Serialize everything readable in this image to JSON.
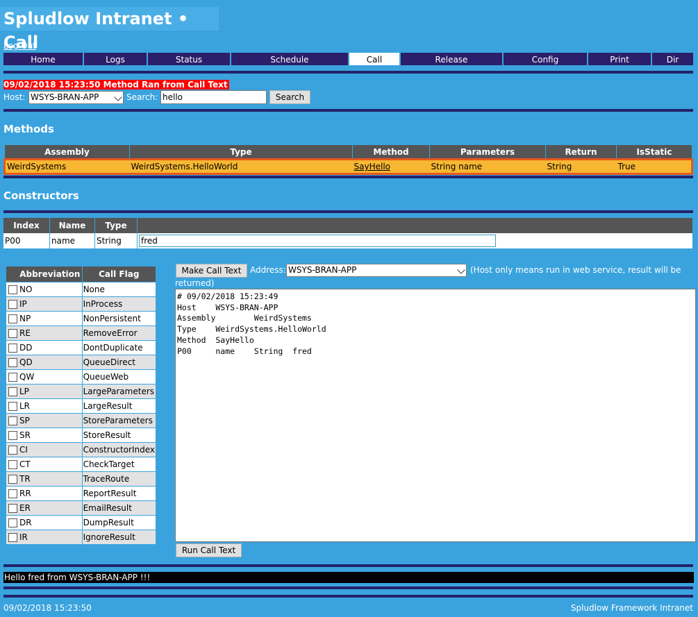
{
  "header": {
    "title": "Spludlow Intranet • Call",
    "logout": "Log Out"
  },
  "nav": {
    "tabs": [
      {
        "label": "Home"
      },
      {
        "label": "Logs"
      },
      {
        "label": "Status"
      },
      {
        "label": "Schedule"
      },
      {
        "label": "Call"
      },
      {
        "label": "Release"
      },
      {
        "label": "Config"
      },
      {
        "label": "Print"
      },
      {
        "label": "Dir"
      }
    ],
    "active": "Call"
  },
  "status_message": "09/02/2018 15:23:50 Method Ran from Call Text",
  "host_row": {
    "host_label": "Host:",
    "host_value": "WSYS-BRAN-APP",
    "search_label": "Search:",
    "search_value": "hello",
    "search_button": "Search"
  },
  "methods": {
    "heading": "Methods",
    "columns": [
      "Assembly",
      "Type",
      "Method",
      "Parameters",
      "Return",
      "IsStatic"
    ],
    "row": {
      "assembly": "WeirdSystems",
      "type": "WeirdSystems.HelloWorld",
      "method": "SayHello",
      "parameters": "String name",
      "return": "String",
      "is_static": "True"
    }
  },
  "constructors": {
    "heading": "Constructors",
    "columns": [
      "Index",
      "Name",
      "Type",
      ""
    ],
    "row": {
      "index": "P00",
      "name": "name",
      "type": "String",
      "value": "fred"
    }
  },
  "flags": {
    "columns": [
      "Abbreviation",
      "Call Flag"
    ],
    "rows": [
      {
        "abbr": "NO",
        "flag": "None"
      },
      {
        "abbr": "IP",
        "flag": "InProcess"
      },
      {
        "abbr": "NP",
        "flag": "NonPersistent"
      },
      {
        "abbr": "RE",
        "flag": "RemoveError"
      },
      {
        "abbr": "DD",
        "flag": "DontDuplicate"
      },
      {
        "abbr": "QD",
        "flag": "QueueDirect"
      },
      {
        "abbr": "QW",
        "flag": "QueueWeb"
      },
      {
        "abbr": "LP",
        "flag": "LargeParameters"
      },
      {
        "abbr": "LR",
        "flag": "LargeResult"
      },
      {
        "abbr": "SP",
        "flag": "StoreParameters"
      },
      {
        "abbr": "SR",
        "flag": "StoreResult"
      },
      {
        "abbr": "CI",
        "flag": "ConstructorIndex"
      },
      {
        "abbr": "CT",
        "flag": "CheckTarget"
      },
      {
        "abbr": "TR",
        "flag": "TraceRoute"
      },
      {
        "abbr": "RR",
        "flag": "ReportResult"
      },
      {
        "abbr": "ER",
        "flag": "EmailResult"
      },
      {
        "abbr": "DR",
        "flag": "DumpResult"
      },
      {
        "abbr": "IR",
        "flag": "IgnoreResult"
      }
    ]
  },
  "call": {
    "make_button": "Make Call Text",
    "address_label": "Address:",
    "address_value": "WSYS-BRAN-APP",
    "note_line1": "(Host only means run in web service, result will be",
    "note_line2": "returned)",
    "call_text": "# 09/02/2018 15:23:49\nHost    WSYS-BRAN-APP\nAssembly        WeirdSystems\nType    WeirdSystems.HelloWorld\nMethod  SayHello\nP00     name    String  fred",
    "run_button": "Run Call Text"
  },
  "result_text": "Hello fred from WSYS-BRAN-APP !!!",
  "footer": {
    "timestamp": "09/02/2018 15:23:50",
    "brand": "Spludlow Framework Intranet"
  },
  "colors": {
    "background": "#3aa3de",
    "nav": "#2b1f6b",
    "rule": "#22226a",
    "highlight_row": "#f7b733",
    "highlight_border": "#e8561a",
    "alert": "#ff0000"
  }
}
